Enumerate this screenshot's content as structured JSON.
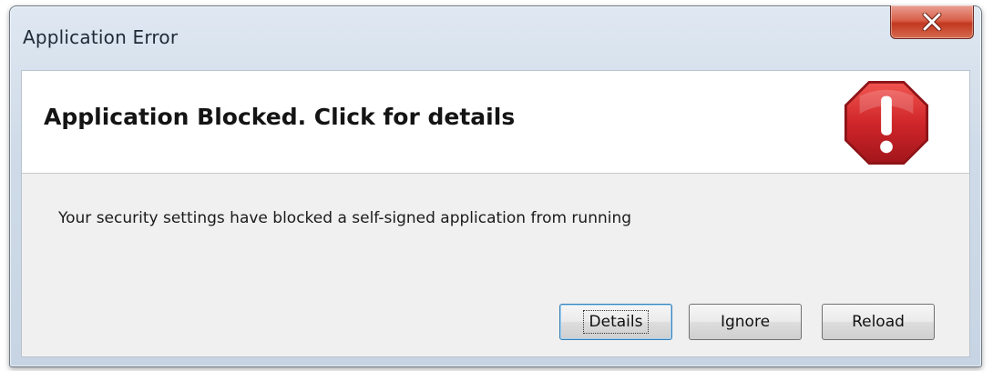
{
  "window": {
    "title": "Application Error"
  },
  "icons": {
    "close": "close-icon",
    "error": "error-stop-icon"
  },
  "colors": {
    "close_button": "#c2381f",
    "error_icon": "#cc1f26"
  },
  "header": {
    "title": "Application Blocked. Click for details"
  },
  "body": {
    "message": "Your security settings have blocked a self-signed application from running"
  },
  "buttons": {
    "details": "Details",
    "ignore": "Ignore",
    "reload": "Reload"
  }
}
